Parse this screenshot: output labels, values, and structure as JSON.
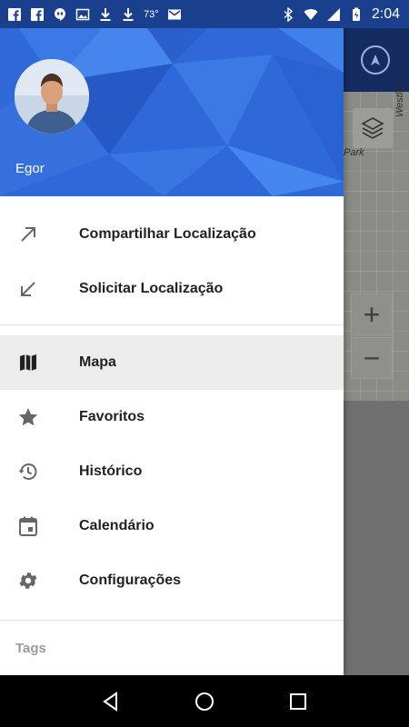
{
  "status_bar": {
    "left_icons": [
      "facebook-icon",
      "facebook-icon",
      "hangouts-icon",
      "image-icon",
      "download-icon",
      "download-icon"
    ],
    "temperature": "73°",
    "right_icons": [
      "mail-icon",
      "bluetooth-icon",
      "wifi-icon",
      "signal-icon",
      "battery-icon"
    ],
    "time": "2:04"
  },
  "drawer": {
    "user": {
      "name": "Egor"
    },
    "share_items": [
      {
        "label": "Compartilhar Localização",
        "icon": "arrow-up-right-icon"
      },
      {
        "label": "Solicitar Localização",
        "icon": "arrow-down-left-icon"
      }
    ],
    "nav_items": [
      {
        "label": "Mapa",
        "icon": "map-icon",
        "selected": true
      },
      {
        "label": "Favoritos",
        "icon": "star-icon",
        "selected": false
      },
      {
        "label": "Histórico",
        "icon": "history-icon",
        "selected": false
      },
      {
        "label": "Calendário",
        "icon": "calendar-icon",
        "selected": false
      },
      {
        "label": "Configurações",
        "icon": "gear-icon",
        "selected": false
      }
    ],
    "subheader": "Tags"
  },
  "map": {
    "labels": {
      "street": "Westlake",
      "park": "Park"
    },
    "zoom_in": "+",
    "zoom_out": "−"
  },
  "nav_bar": {
    "buttons": [
      "back-icon",
      "home-icon",
      "recents-icon"
    ]
  },
  "colors": {
    "header_blue": "#2f69d9",
    "status_bar": "#1a3f8c",
    "selected_row": "#ececec"
  }
}
